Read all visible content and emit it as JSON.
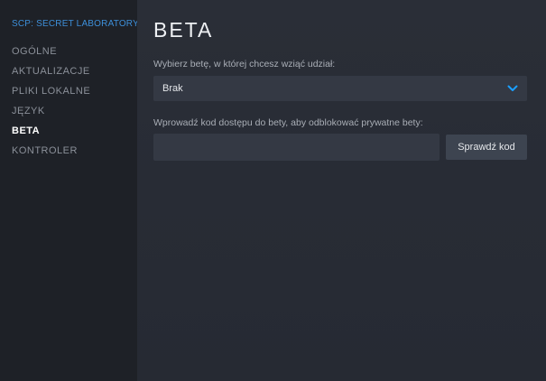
{
  "sidebar": {
    "app_title": "SCP: SECRET LABORATORY",
    "items": [
      {
        "label": "OGÓLNE"
      },
      {
        "label": "AKTUALIZACJE"
      },
      {
        "label": "PLIKI LOKALNE"
      },
      {
        "label": "JĘZYK"
      },
      {
        "label": "BETA"
      },
      {
        "label": "KONTROLER"
      }
    ],
    "active_item": "BETA"
  },
  "main": {
    "title": "BETA",
    "beta_select": {
      "label": "Wybierz betę, w której chcesz wziąć udział:",
      "value": "Brak",
      "icon": "chevron-down-icon"
    },
    "access_code": {
      "label": "Wprowadź kod dostępu do bety, aby odblokować prywatne bety:",
      "value": "",
      "placeholder": ""
    },
    "check_button_label": "Sprawdź kod"
  },
  "colors": {
    "sidebar_bg": "#1e2127",
    "main_bg": "#2a2e37",
    "accent": "#3d8fd9",
    "input_bg": "#343944",
    "button_bg": "#3d4450",
    "chevron": "#1a9fff"
  }
}
